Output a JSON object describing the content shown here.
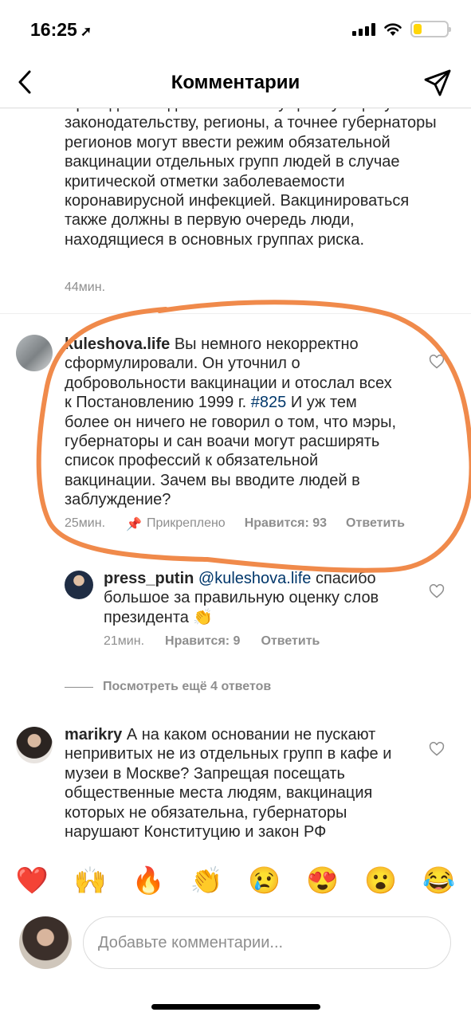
{
  "status": {
    "time": "16:25",
    "location_icon": "location-arrow-icon",
    "signal_icon": "signal-icon",
    "wifi_icon": "wifi-icon",
    "battery_level": 0.25,
    "battery_color": "#ffd60a"
  },
  "header": {
    "title": "Комментарии",
    "back_icon": "chevron-left-icon",
    "send_icon": "paper-plane-icon"
  },
  "caption": {
    "text": "Президентом дал ответ: по существующему законодательству, регионы, а точнее губернаторы регионов могут ввести режим обязательной вакцинации отдельных групп людей в случае критической отметки заболеваемости коронавирусной инфекцией. Вакцинироваться также должны в первую очередь люди, находящиеся в основных группах риска.",
    "time": "44мин."
  },
  "comments": [
    {
      "username": "kuleshova.life",
      "text_before": "Вы немного некорректно сформулировали. Он уточнил о добровольности вакцинации и отослал всех к Постановлению 1999 г.",
      "hashtag": "#825",
      "text_after": "И уж тем более он ничего не говорил о том, что мэры, губернаторы и сан воачи могут расширять список профессий к обязательной вакцинации. Зачем вы вводите людей в заблуждение?",
      "time": "25мин.",
      "pinned": "Прикреплено",
      "likes": "Нравится: 93",
      "reply": "Ответить",
      "highlight_color": "#f08a4b"
    },
    {
      "username": "press_putin",
      "mention": "@kuleshova.life",
      "text": "спасибо большое за правильную оценку слов президента 👏",
      "time": "21мин.",
      "likes": "Нравится: 9",
      "reply": "Ответить"
    },
    {
      "username": "marikry",
      "text": "А на каком основании не пускают непривитых не из отдельных групп в кафе и музеи в Москве? Запрещая посещать общественные места людям, вакцинация которых не обязательна, губернаторы нарушают Конституцию и закон РФ"
    }
  ],
  "view_more": "Посмотреть ещё 4 ответов",
  "emoji_bar": [
    "❤️",
    "🙌",
    "🔥",
    "👏",
    "😢",
    "😍",
    "😮",
    "😂"
  ],
  "composer": {
    "placeholder": "Добавьте комментарии..."
  }
}
